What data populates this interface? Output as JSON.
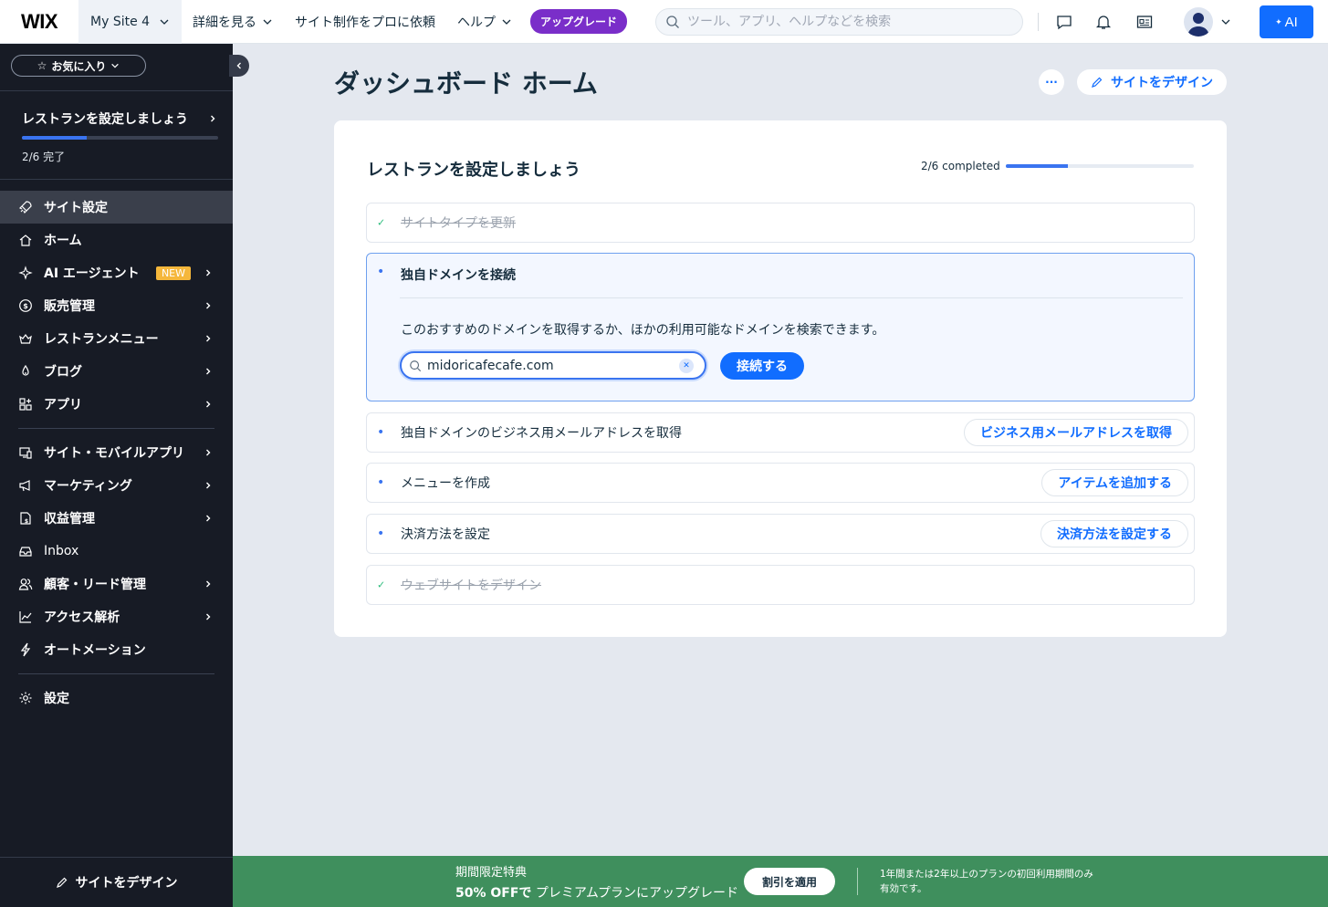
{
  "topbar": {
    "logo": "WIX",
    "site_name": "My Site 4",
    "nav": [
      "詳細を見る",
      "サイト制作をプロに依頼",
      "ヘルプ"
    ],
    "upgrade_label": "アップグレード",
    "search_placeholder": "ツール、アプリ、ヘルプなどを検索",
    "ai_label": "AI"
  },
  "sidebar": {
    "favorites_label": "お気に入り",
    "setup": {
      "title": "レストランを設定しましょう",
      "progress_label": "2/6 完了",
      "progress_fraction": 0.33
    },
    "items": [
      {
        "label": "サイト設定",
        "icon": "rocket-icon",
        "chevron": false,
        "active": true
      },
      {
        "label": "ホーム",
        "icon": "home-icon",
        "chevron": false
      },
      {
        "label": "AI エージェント",
        "icon": "sparkle-icon",
        "chevron": true,
        "badge": "NEW"
      },
      {
        "label": "販売管理",
        "icon": "dollar-icon",
        "chevron": true
      },
      {
        "label": "レストランメニュー",
        "icon": "crown-icon",
        "chevron": true
      },
      {
        "label": "ブログ",
        "icon": "pen-nib-icon",
        "chevron": true
      },
      {
        "label": "アプリ",
        "icon": "apps-icon",
        "chevron": true
      },
      {
        "label": "サイト・モバイルアプリ",
        "icon": "devices-icon",
        "chevron": true
      },
      {
        "label": "マーケティング",
        "icon": "megaphone-icon",
        "chevron": true
      },
      {
        "label": "収益管理",
        "icon": "revenue-icon",
        "chevron": true
      },
      {
        "label": "Inbox",
        "icon": "inbox-icon",
        "chevron": false
      },
      {
        "label": "顧客・リード管理",
        "icon": "contacts-icon",
        "chevron": true
      },
      {
        "label": "アクセス解析",
        "icon": "analytics-icon",
        "chevron": true
      },
      {
        "label": "オートメーション",
        "icon": "automation-icon",
        "chevron": false
      },
      {
        "label": "設定",
        "icon": "gear-icon",
        "chevron": false
      }
    ],
    "design_label": "サイトをデザイン"
  },
  "main": {
    "page_title": "ダッシュボード ホーム",
    "more_label": "···",
    "design_button": "サイトをデザイン",
    "card": {
      "title": "レストランを設定しましょう",
      "progress_label": "2/6 completed",
      "progress_fraction": 0.33,
      "steps": [
        {
          "label": "サイトタイプを更新",
          "done": true
        },
        {
          "label": "独自ドメインを接続",
          "open": true,
          "description": "このおすすめのドメインを取得するか、ほかの利用可能なドメインを検索できます。",
          "input_value": "midoricafecafe.com",
          "button": "接続する"
        },
        {
          "label": "独自ドメインのビジネス用メールアドレスを取得",
          "button": "ビジネス用メールアドレスを取得"
        },
        {
          "label": "メニューを作成",
          "button": "アイテムを追加する"
        },
        {
          "label": "決済方法を設定",
          "button": "決済方法を設定する"
        },
        {
          "label": "ウェブサイトをデザイン",
          "done": true
        }
      ]
    }
  },
  "promo": {
    "line1": "期間限定特典",
    "line2_bold": "50% OFFで",
    "line2_rest": "プレミアムプランにアップグレード",
    "apply_label": "割引を適用",
    "note": "1年間または2年以上のプランの初回利用期間のみ有効です。"
  },
  "colors": {
    "accent": "#116dff",
    "sidebar_bg": "#171b25",
    "upgrade": "#7a2ec9",
    "promo_bg": "#3f8f5d",
    "check": "#2cbc7c"
  }
}
